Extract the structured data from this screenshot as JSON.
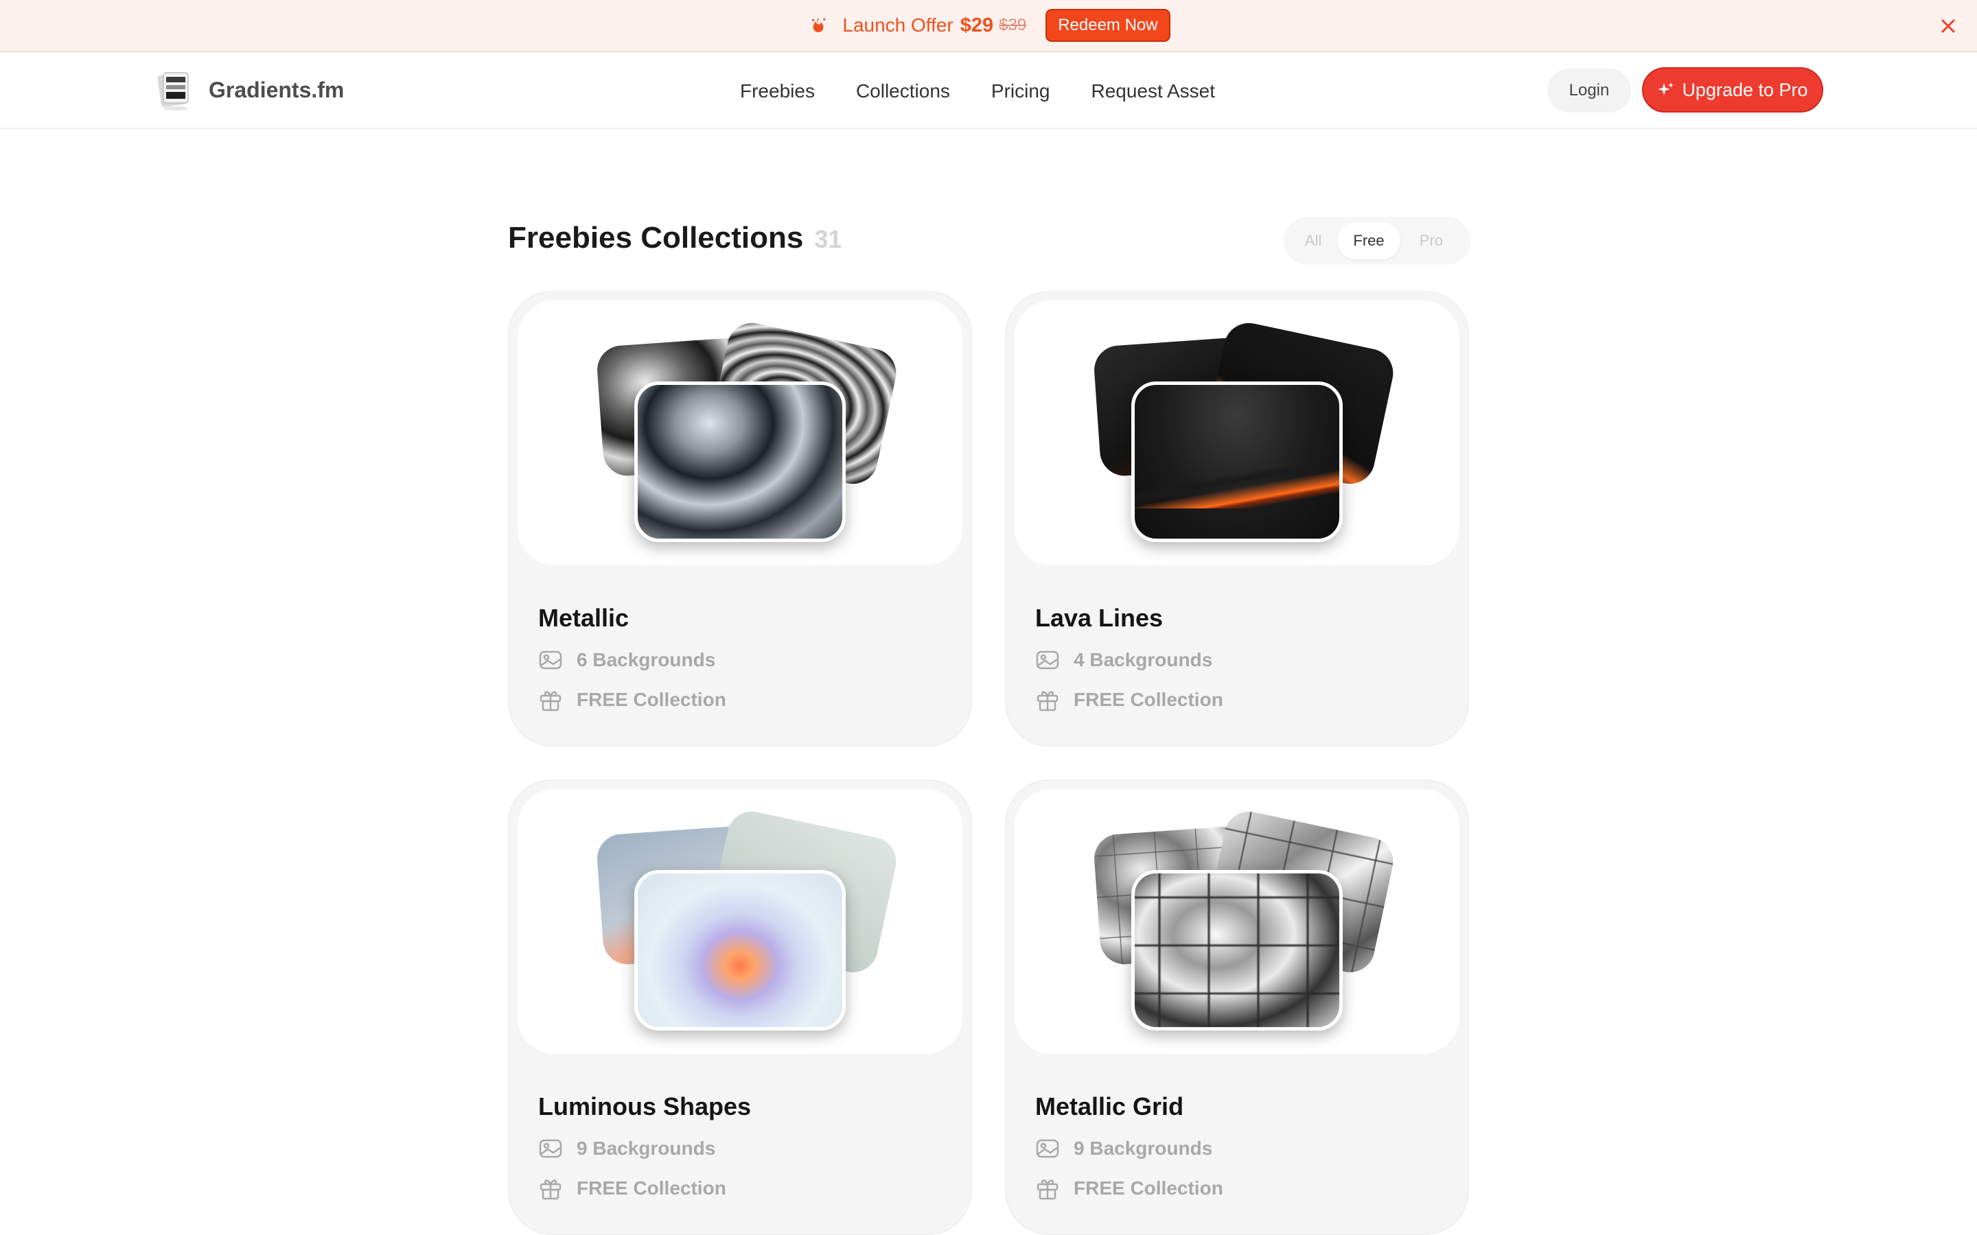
{
  "banner": {
    "offer_label": "Launch Offer",
    "price": "$29",
    "old_price": "$39",
    "redeem_label": "Redeem Now",
    "close_icon": "close-icon",
    "fire_icon": "fire-icon"
  },
  "header": {
    "brand": "Gradients.fm",
    "nav": [
      "Freebies",
      "Collections",
      "Pricing",
      "Request Asset"
    ],
    "login_label": "Login",
    "upgrade_label": "Upgrade to Pro",
    "accent_color": "#ee3b30"
  },
  "section": {
    "title": "Freebies Collections",
    "count": "31",
    "filters": [
      "All",
      "Free",
      "Pro"
    ],
    "active_filter": "Free"
  },
  "cards": [
    {
      "title": "Metallic",
      "backgrounds": "6 Backgrounds",
      "collection": "FREE Collection"
    },
    {
      "title": "Lava Lines",
      "backgrounds": "4 Backgrounds",
      "collection": "FREE Collection"
    },
    {
      "title": "Luminous Shapes",
      "backgrounds": "9 Backgrounds",
      "collection": "FREE Collection"
    },
    {
      "title": "Metallic Grid",
      "backgrounds": "9 Backgrounds",
      "collection": "FREE Collection"
    }
  ]
}
